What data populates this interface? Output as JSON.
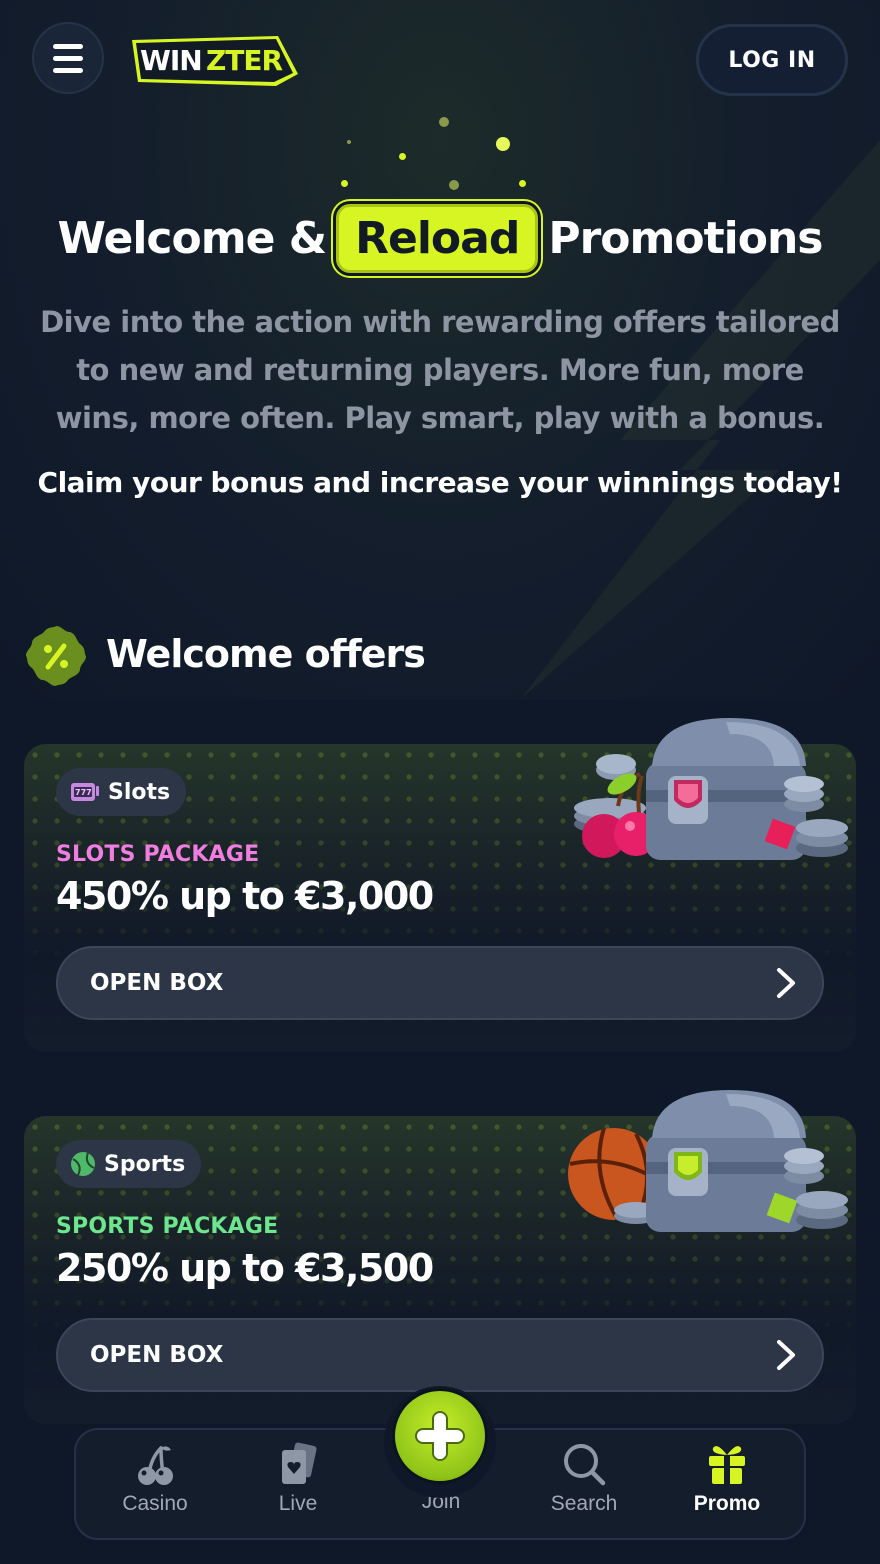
{
  "header": {
    "logo_text": "WINZTER",
    "login_label": "LOG IN"
  },
  "hero": {
    "title_before": "Welcome &",
    "title_highlight": "Reload",
    "title_after": "Promotions",
    "subtitle": "Dive into the action with rewarding offers tailored to new and returning players. More fun, more wins, more often. Play smart, play with a bonus.",
    "claim": "Claim your bonus and increase your winnings today!"
  },
  "welcome_section": {
    "title": "Welcome offers",
    "offers": [
      {
        "tag": "Slots",
        "package_label": "SLOTS PACKAGE",
        "package_color": "#f07de0",
        "amount": "450% up to €3,000",
        "button_label": "OPEN BOX",
        "tag_icon": "slot-machine-icon",
        "gem_color": "#f2386c"
      },
      {
        "tag": "Sports",
        "package_label": "SPORTS PACKAGE",
        "package_color": "#6ee68e",
        "amount": "250% up to €3,500",
        "button_label": "OPEN BOX",
        "tag_icon": "tennis-ball-icon",
        "gem_color": "#b4e62a"
      }
    ]
  },
  "bottom_nav": {
    "items": [
      {
        "label": "Casino",
        "icon": "cherry-icon",
        "active": false
      },
      {
        "label": "Live",
        "icon": "cards-icon",
        "active": false
      },
      {
        "label": "Join",
        "icon": "plus-icon",
        "active": false
      },
      {
        "label": "Search",
        "icon": "search-icon",
        "active": false
      },
      {
        "label": "Promo",
        "icon": "gift-icon",
        "active": true
      }
    ]
  },
  "colors": {
    "accent": "#d7f522",
    "background": "#0f1828",
    "card": "#1c2636"
  }
}
